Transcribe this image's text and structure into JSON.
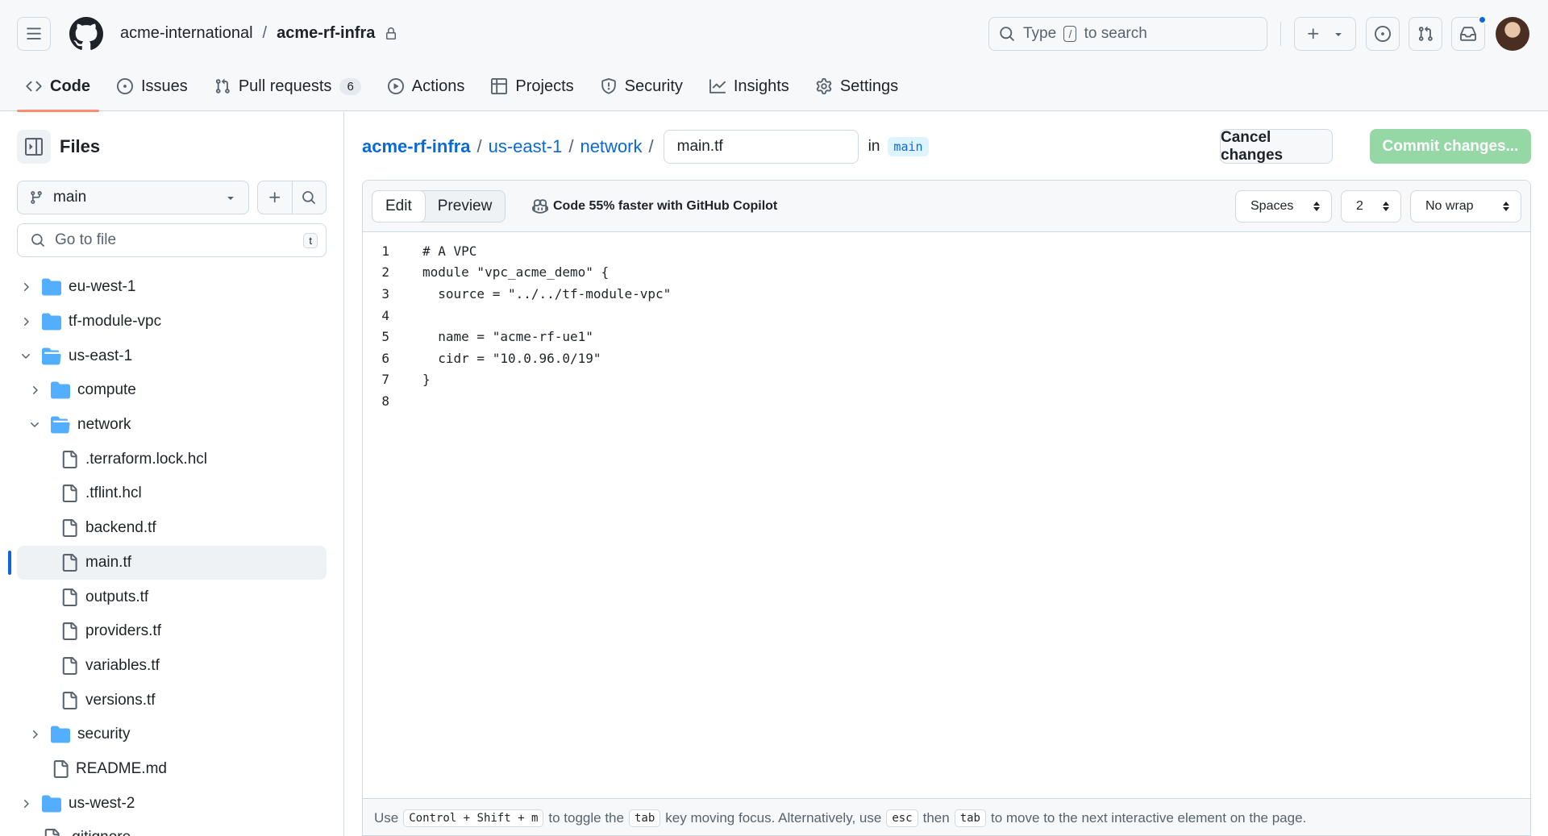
{
  "header": {
    "org": "acme-international",
    "separator": "/",
    "repo": "acme-rf-infra",
    "search": {
      "prefix": "Type",
      "key": "/",
      "suffix": "to search"
    }
  },
  "repo_tabs": [
    {
      "label": "Code",
      "icon": "code-icon",
      "active": true
    },
    {
      "label": "Issues",
      "icon": "issue-opened-icon"
    },
    {
      "label": "Pull requests",
      "icon": "git-pull-request-icon",
      "count": "6"
    },
    {
      "label": "Actions",
      "icon": "play-icon"
    },
    {
      "label": "Projects",
      "icon": "table-icon"
    },
    {
      "label": "Security",
      "icon": "shield-icon"
    },
    {
      "label": "Insights",
      "icon": "graph-icon"
    },
    {
      "label": "Settings",
      "icon": "gear-icon"
    }
  ],
  "sidebar": {
    "title": "Files",
    "branch": "main",
    "goto_placeholder": "Go to file",
    "goto_shortcut": "t",
    "tree": [
      {
        "label": "eu-west-1",
        "type": "folder",
        "depth": 0,
        "expanded": false
      },
      {
        "label": "tf-module-vpc",
        "type": "folder",
        "depth": 0,
        "expanded": false
      },
      {
        "label": "us-east-1",
        "type": "folder",
        "depth": 0,
        "expanded": true
      },
      {
        "label": "compute",
        "type": "folder",
        "depth": 1,
        "expanded": false
      },
      {
        "label": "network",
        "type": "folder",
        "depth": 1,
        "expanded": true
      },
      {
        "label": ".terraform.lock.hcl",
        "type": "file",
        "depth": 2
      },
      {
        "label": ".tflint.hcl",
        "type": "file",
        "depth": 2
      },
      {
        "label": "backend.tf",
        "type": "file",
        "depth": 2
      },
      {
        "label": "main.tf",
        "type": "file",
        "depth": 2,
        "selected": true
      },
      {
        "label": "outputs.tf",
        "type": "file",
        "depth": 2
      },
      {
        "label": "providers.tf",
        "type": "file",
        "depth": 2
      },
      {
        "label": "variables.tf",
        "type": "file",
        "depth": 2
      },
      {
        "label": "versions.tf",
        "type": "file",
        "depth": 2
      },
      {
        "label": "security",
        "type": "folder",
        "depth": 1,
        "expanded": false
      },
      {
        "label": "README.md",
        "type": "file",
        "depth": 1
      },
      {
        "label": "us-west-2",
        "type": "folder",
        "depth": 0,
        "expanded": false
      },
      {
        "label": ".gitignore",
        "type": "file",
        "depth": 0
      }
    ]
  },
  "breadcrumb": {
    "parts": [
      "acme-rf-infra",
      "us-east-1",
      "network"
    ],
    "filename": "main.tf",
    "in_label": "in",
    "branch": "main"
  },
  "actions": {
    "cancel": "Cancel changes",
    "commit": "Commit changes..."
  },
  "editor": {
    "tabs": [
      "Edit",
      "Preview"
    ],
    "copilot_text": "Code 55% faster with GitHub Copilot",
    "indent_mode": "Spaces",
    "indent_size": "2",
    "wrap_mode": "No wrap",
    "lines": [
      "# A VPC",
      "module \"vpc_acme_demo\" {",
      "  source = \"../../tf-module-vpc\"",
      "",
      "  name = \"acme-rf-ue1\"",
      "  cidr = \"10.0.96.0/19\"",
      "}",
      ""
    ],
    "footer": {
      "t1": "Use",
      "k1": "Control + Shift + m",
      "t2": "to toggle the",
      "k2": "tab",
      "t3": "key moving focus. Alternatively, use",
      "k3": "esc",
      "t4": "then",
      "k4": "tab",
      "t5": "to move to the next interactive element on the page."
    }
  },
  "colors": {
    "accent": "#0969da",
    "commit_disabled": "#95d8a6",
    "active_tab_underline": "#fd8c73",
    "folder": "#54aeff",
    "notification": "#0969da"
  }
}
